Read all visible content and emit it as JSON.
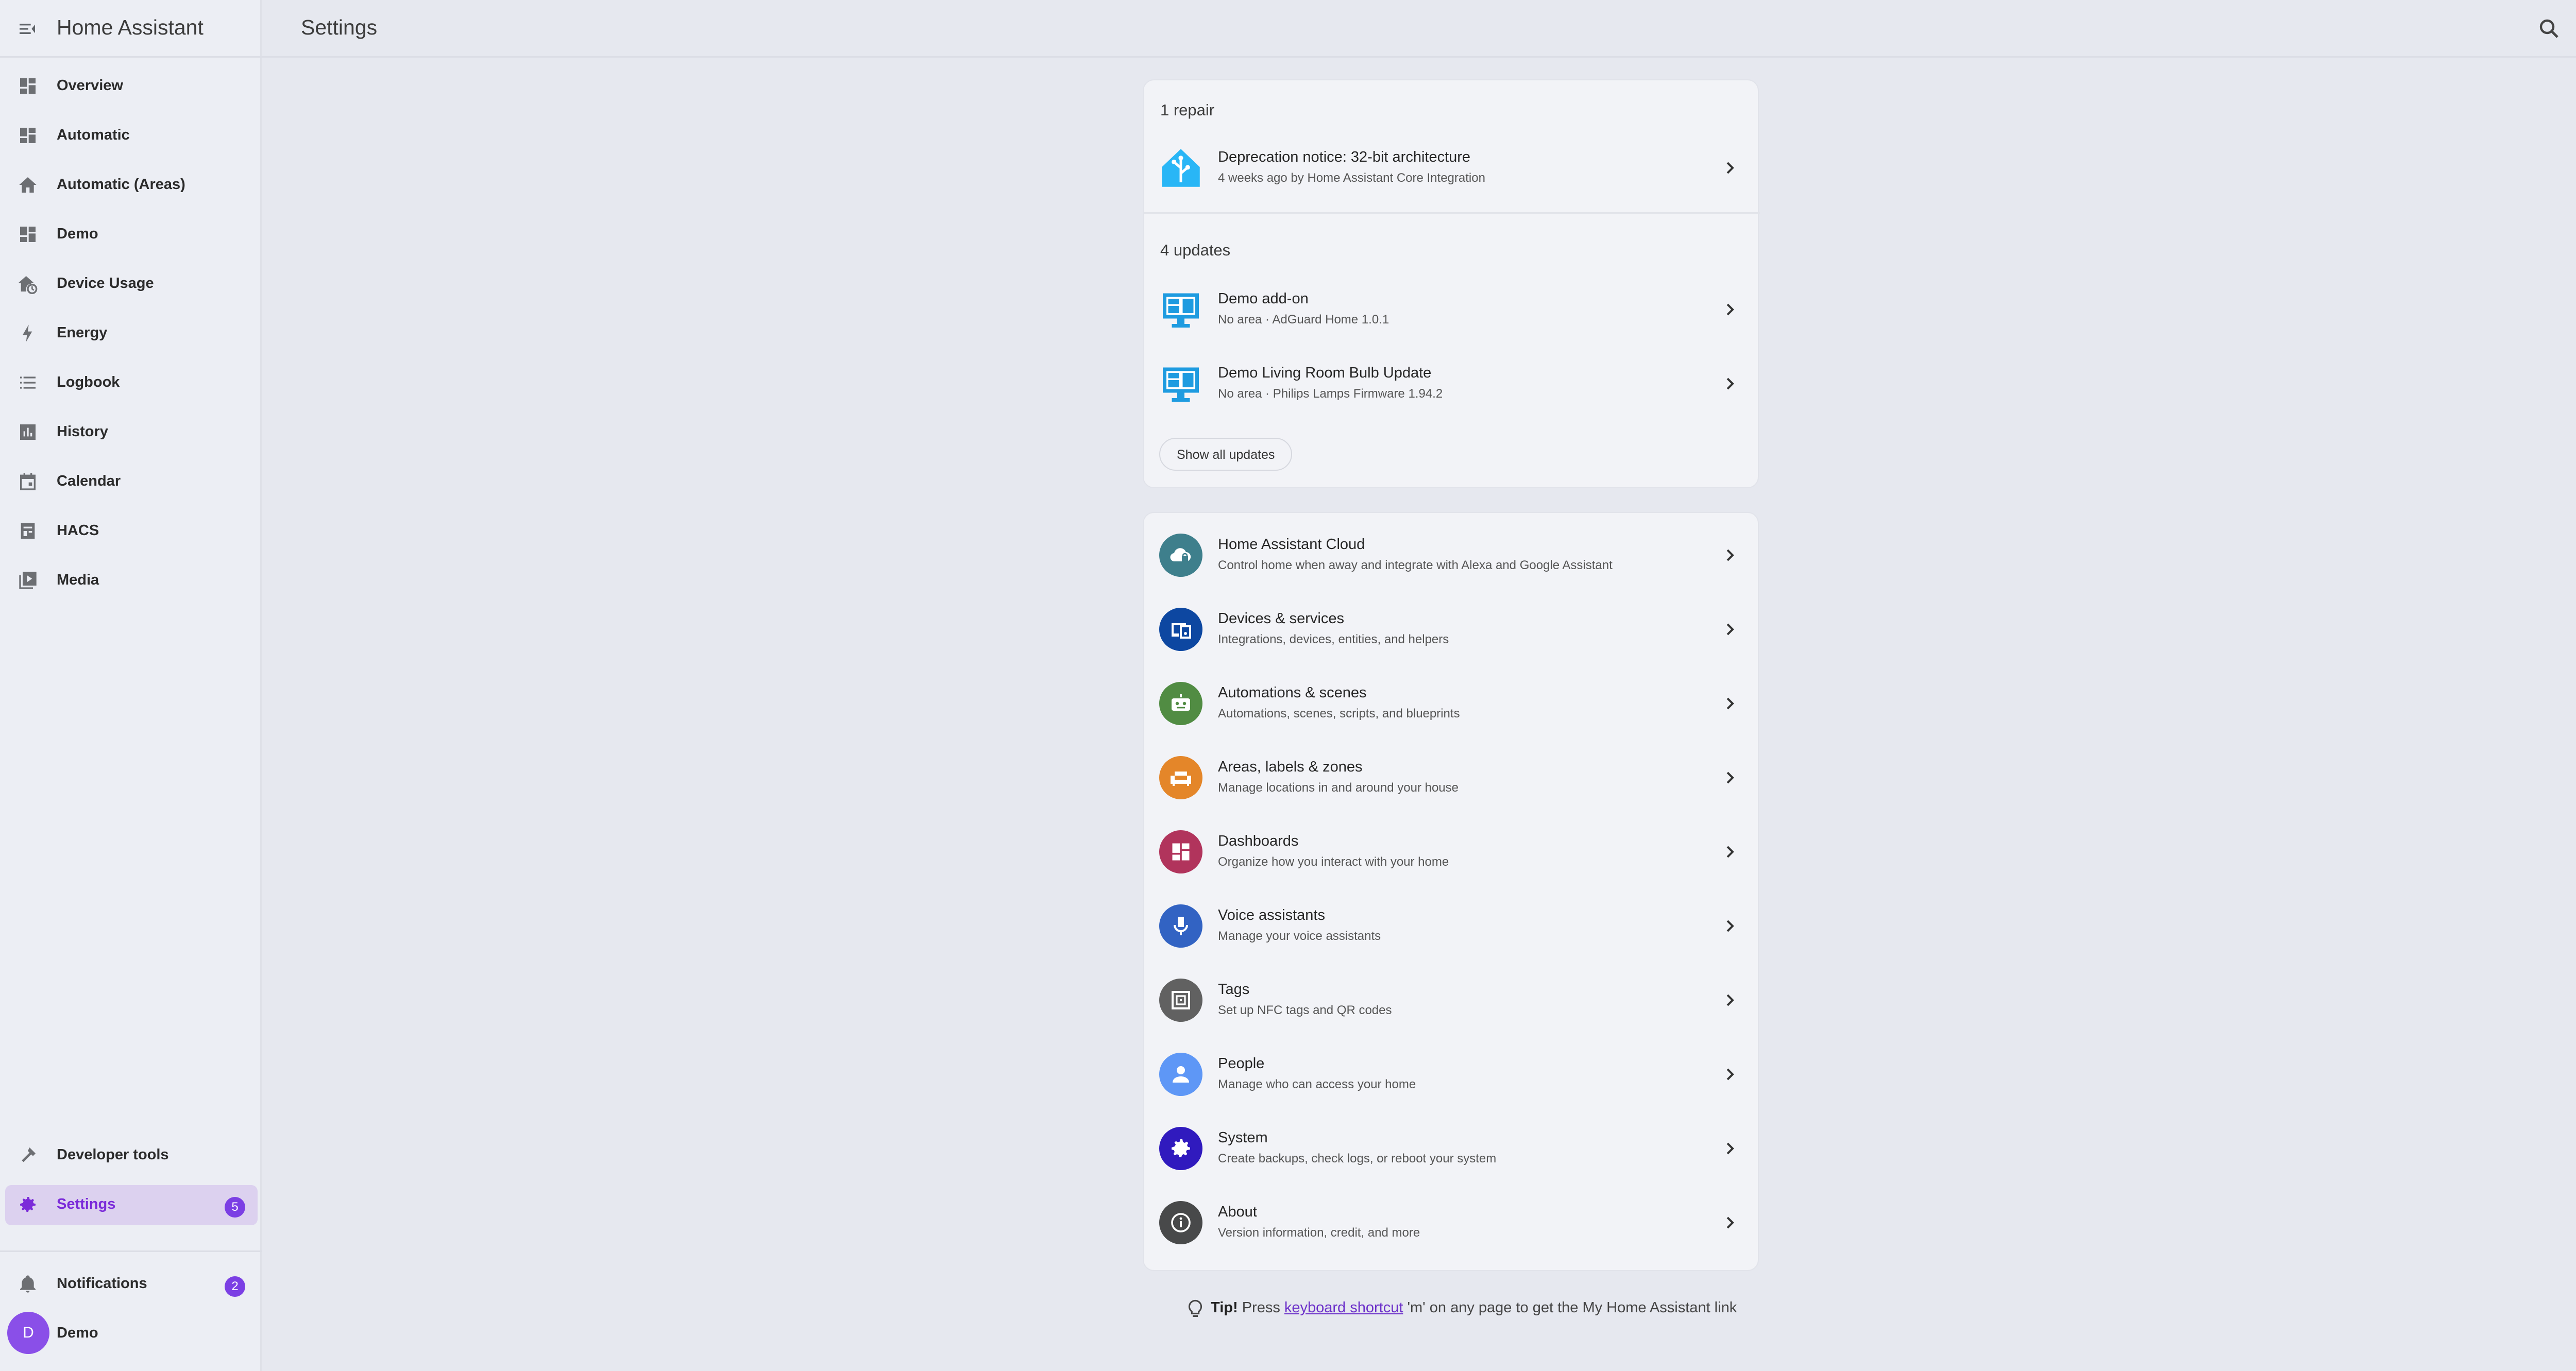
{
  "app_title": "Home Assistant",
  "page_title": "Settings",
  "sidebar": {
    "items": [
      {
        "label": "Overview",
        "icon": "dashboard-icon"
      },
      {
        "label": "Automatic",
        "icon": "dashboard-icon"
      },
      {
        "label": "Automatic (Areas)",
        "icon": "home-icon"
      },
      {
        "label": "Demo",
        "icon": "dashboard-icon"
      },
      {
        "label": "Device Usage",
        "icon": "home-clock-icon"
      },
      {
        "label": "Energy",
        "icon": "lightning-icon"
      },
      {
        "label": "Logbook",
        "icon": "list-icon"
      },
      {
        "label": "History",
        "icon": "chart-box-icon"
      },
      {
        "label": "Calendar",
        "icon": "calendar-icon"
      },
      {
        "label": "HACS",
        "icon": "hacs-icon"
      },
      {
        "label": "Media",
        "icon": "play-box-icon"
      }
    ],
    "developer_tools": "Developer tools",
    "settings": "Settings",
    "settings_badge": "5",
    "notifications": "Notifications",
    "notifications_badge": "2",
    "user_name": "Demo",
    "user_initial": "D"
  },
  "repairs": {
    "heading": "1 repair",
    "items": [
      {
        "title": "Deprecation notice: 32-bit architecture",
        "subtitle": "4 weeks ago by Home Assistant Core Integration"
      }
    ]
  },
  "updates": {
    "heading": "4 updates",
    "items": [
      {
        "title": "Demo add-on",
        "subtitle": "No area · AdGuard Home 1.0.1"
      },
      {
        "title": "Demo Living Room Bulb Update",
        "subtitle": "No area · Philips Lamps Firmware 1.94.2"
      }
    ],
    "show_all": "Show all updates"
  },
  "settings_items": [
    {
      "title": "Home Assistant Cloud",
      "subtitle": "Control home when away and integrate with Alexa and Google Assistant",
      "icon": "cloud-lock-icon",
      "color": "#3e7f8c"
    },
    {
      "title": "Devices & services",
      "subtitle": "Integrations, devices, entities, and helpers",
      "icon": "devices-icon",
      "color": "#0d47a1"
    },
    {
      "title": "Automations & scenes",
      "subtitle": "Automations, scenes, scripts, and blueprints",
      "icon": "robot-icon",
      "color": "#518c43"
    },
    {
      "title": "Areas, labels & zones",
      "subtitle": "Manage locations in and around your house",
      "icon": "sofa-icon",
      "color": "#e48629"
    },
    {
      "title": "Dashboards",
      "subtitle": "Organize how you interact with your home",
      "icon": "dashboard-icon",
      "color": "#b1345c"
    },
    {
      "title": "Voice assistants",
      "subtitle": "Manage your voice assistants",
      "icon": "microphone-icon",
      "color": "#3263c3"
    },
    {
      "title": "Tags",
      "subtitle": "Set up NFC tags and QR codes",
      "icon": "nfc-icon",
      "color": "#616161"
    },
    {
      "title": "People",
      "subtitle": "Manage who can access your home",
      "icon": "account-icon",
      "color": "#5e97f6"
    },
    {
      "title": "System",
      "subtitle": "Create backups, check logs, or reboot your system",
      "icon": "cog-icon",
      "color": "#301ABE"
    },
    {
      "title": "About",
      "subtitle": "Version information, credit, and more",
      "icon": "information-icon",
      "color": "#48494a"
    }
  ],
  "tip": {
    "prefix": "Tip!",
    "before": "Press",
    "link": "keyboard shortcut",
    "after": "'m' on any page to get the My Home Assistant link"
  }
}
